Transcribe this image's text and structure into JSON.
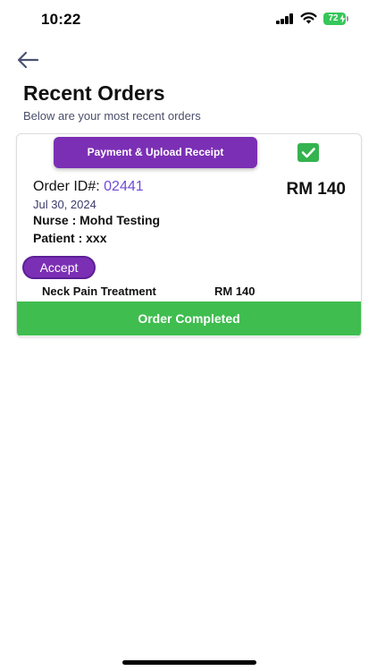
{
  "status_bar": {
    "time": "10:22",
    "battery": "72"
  },
  "header": {
    "back_icon": "arrow-left-icon",
    "title": "Recent Orders",
    "subtitle": "Below are your most recent orders"
  },
  "order": {
    "payment_button_label": "Payment & Upload Receipt",
    "completed_checked": true,
    "order_id_label": "Order ID#:",
    "order_id": "02441",
    "total": "RM 140",
    "date": "Jul 30, 2024",
    "nurse": "Nurse : Mohd Testing",
    "patient": "Patient : xxx",
    "accept_label": "Accept",
    "item": {
      "name": "Neck Pain Treatment",
      "price": "RM 140"
    },
    "status": "Order Completed"
  },
  "colors": {
    "accent_purple": "#7b2fb5",
    "order_id_color": "#6f4bd8",
    "success_green": "#3fbd4f"
  }
}
